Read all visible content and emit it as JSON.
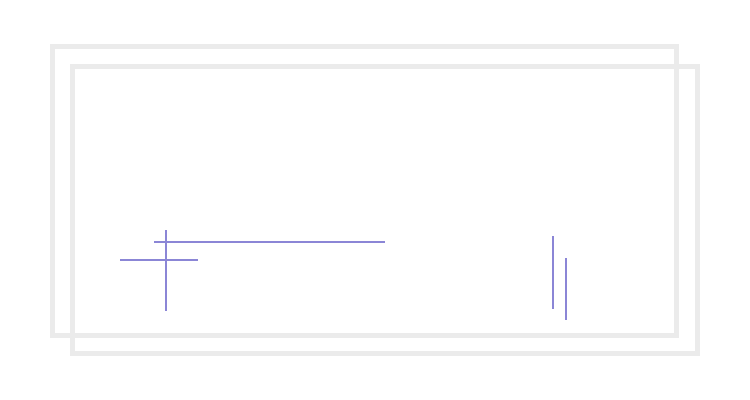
{
  "colors": {
    "background": "#ffffff",
    "frame": "#ebebeb",
    "line": "#8b86d6"
  },
  "elements": {
    "frames": [
      "back-frame",
      "front-frame"
    ],
    "lines": [
      "horizontal-long",
      "horizontal-short",
      "vertical-cross",
      "vertical-right-a",
      "vertical-right-b"
    ]
  }
}
